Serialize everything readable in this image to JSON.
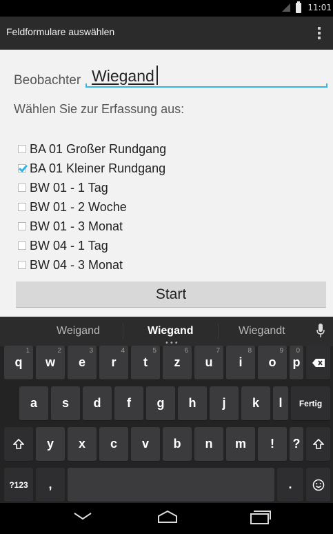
{
  "status_bar": {
    "time": "11:01"
  },
  "action_bar": {
    "title": "Feldformulare auswählen"
  },
  "form": {
    "observer_label": "Beobachter",
    "observer_value": "Wiegand",
    "prompt": "Wählen Sie zur Erfassung aus:",
    "options": [
      {
        "label": "BA 01 Großer Rundgang",
        "checked": false
      },
      {
        "label": "BA 01 Kleiner Rundgang",
        "checked": true
      },
      {
        "label": "BW 01 - 1 Tag",
        "checked": false
      },
      {
        "label": "BW 01 - 2 Woche",
        "checked": false
      },
      {
        "label": "BW 01 - 3 Monat",
        "checked": false
      },
      {
        "label": "BW 04 - 1 Tag",
        "checked": false
      },
      {
        "label": "BW 04 - 3 Monat",
        "checked": false
      }
    ],
    "start_label": "Start"
  },
  "keyboard": {
    "suggestions": [
      "Weigand",
      "Wiegand",
      "Wiegandt"
    ],
    "row1": [
      {
        "label": "q",
        "hint": "1"
      },
      {
        "label": "w",
        "hint": "2"
      },
      {
        "label": "e",
        "hint": "3"
      },
      {
        "label": "r",
        "hint": "4"
      },
      {
        "label": "t",
        "hint": "5"
      },
      {
        "label": "z",
        "hint": "6"
      },
      {
        "label": "u",
        "hint": "7"
      },
      {
        "label": "i",
        "hint": "8"
      },
      {
        "label": "o",
        "hint": "9"
      },
      {
        "label": "p",
        "hint": "0"
      }
    ],
    "row2": [
      "a",
      "s",
      "d",
      "f",
      "g",
      "h",
      "j",
      "k",
      "l"
    ],
    "done_label": "Fertig",
    "row3": [
      "y",
      "x",
      "c",
      "v",
      "b",
      "n",
      "m",
      "!",
      "?"
    ],
    "symbols_label": "?123",
    "comma_label": ",",
    "period_label": ".",
    "icons": {
      "backspace": "backspace-icon",
      "shift": "shift-icon",
      "emoji": "emoji-icon",
      "mic": "mic-icon"
    }
  },
  "colors": {
    "accent": "#33b5e5",
    "action_bar": "#2b2b2b",
    "content_bg": "#f2f2f2",
    "keyboard_bg": "#232323",
    "key": "#3b3b3d"
  }
}
